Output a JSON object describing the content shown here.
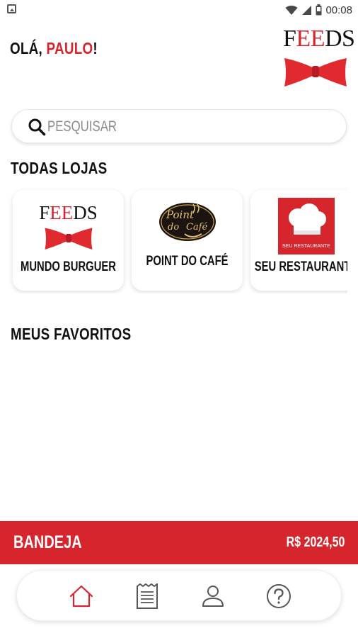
{
  "status_bar": {
    "time": "00:08",
    "icons": [
      "app-notification-icon",
      "wifi-icon",
      "signal-icon",
      "battery-icon"
    ]
  },
  "header": {
    "greeting_prefix": "OLÁ, ",
    "user_name": "PAULO",
    "greeting_suffix": "!",
    "brand_logo": {
      "letters": [
        "F",
        "E",
        "E",
        "D",
        "S"
      ],
      "accent_color": "#d7252d"
    }
  },
  "search": {
    "placeholder": "PESQUISAR",
    "icon": "search-icon"
  },
  "stores_section": {
    "title": "TODAS LOJAS",
    "stores": [
      {
        "name": "MUNDO BURGUER",
        "logo": "feeds-bowtie-logo",
        "logo_text": [
          "F",
          "E",
          "E",
          "D",
          "S"
        ]
      },
      {
        "name": "POINT DO CAFÉ",
        "logo": "point-do-cafe-logo",
        "logo_text": [
          "Point",
          "do",
          "Café"
        ]
      },
      {
        "name": "SEU RESTAURANTE",
        "logo": "chef-hat-logo",
        "logo_text": [
          "SEU RESTAURANTE"
        ]
      }
    ]
  },
  "favorites_section": {
    "title": "MEUS FAVORITOS"
  },
  "tray": {
    "label": "BANDEJA",
    "total": "R$ 2024,50"
  },
  "bottom_nav": {
    "items": [
      {
        "icon": "home-icon",
        "active": true
      },
      {
        "icon": "receipt-icon",
        "active": false
      },
      {
        "icon": "user-icon",
        "active": false
      },
      {
        "icon": "help-icon",
        "active": false
      }
    ]
  },
  "colors": {
    "accent": "#d7252d",
    "text": "#111111",
    "muted": "#8a8a8a",
    "background": "#ffffff"
  }
}
